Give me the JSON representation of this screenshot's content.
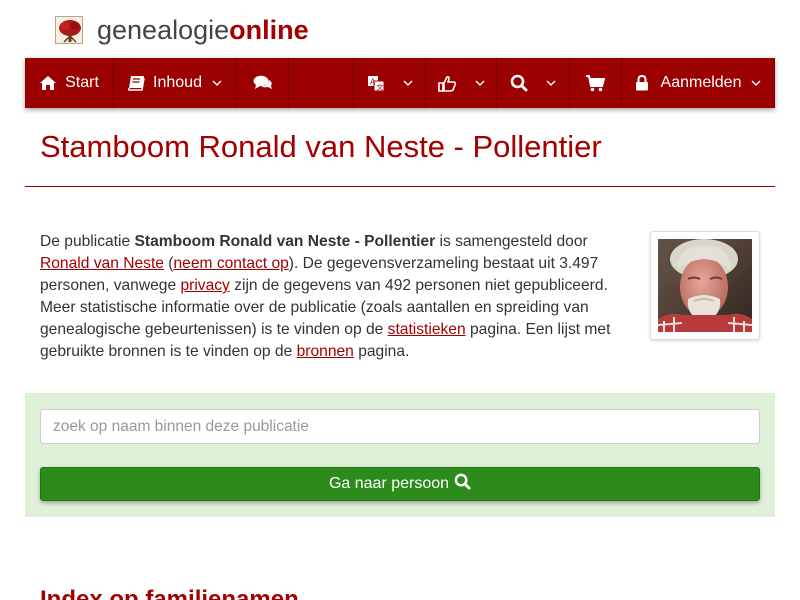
{
  "logo": {
    "part1": "genealogie",
    "part2": "online",
    "icon": "family-tree-logo"
  },
  "nav": {
    "start_label": "Start",
    "inhoud_label": "Inhoud",
    "aanmelden_label": "Aanmelden",
    "icons": [
      "home-icon",
      "book-icon",
      "comments-icon",
      "language-icon",
      "thumbs-up-icon",
      "search-icon",
      "cart-icon",
      "lock-icon",
      "chevron-down-icon"
    ]
  },
  "page": {
    "title": "Stamboom Ronald van Neste - Pollentier"
  },
  "intro": {
    "t1": "De publicatie ",
    "pub_name": "Stamboom Ronald van Neste - Pollentier",
    "t2": " is samengesteld door ",
    "author_link": "Ronald van Neste",
    "t3": " (",
    "contact_link": "neem contact op",
    "t4": "). De gegevensverzameling bestaat uit 3.497 personen, vanwege ",
    "privacy_link": "privacy",
    "t5": " zijn de gegevens van 492 personen niet gepubliceerd. Meer statistische informatie over de publicatie (zoals aantallen en spreiding van genealogische gebeurtenissen) is te vinden op de ",
    "stats_link": "statistieken",
    "t6": " pagina. Een lijst met gebruikte bronnen is te vinden op de ",
    "sources_link": "bronnen",
    "t7": " pagina."
  },
  "search": {
    "placeholder": "zoek op naam binnen deze publicatie",
    "value": "",
    "button_label": "Ga naar persoon"
  },
  "next_section": {
    "title": "Index op familienamen"
  },
  "colors": {
    "brand": "#9b0101",
    "accent_text": "#a40000",
    "panel": "#dff0d8",
    "button": "#2c8b1a"
  }
}
